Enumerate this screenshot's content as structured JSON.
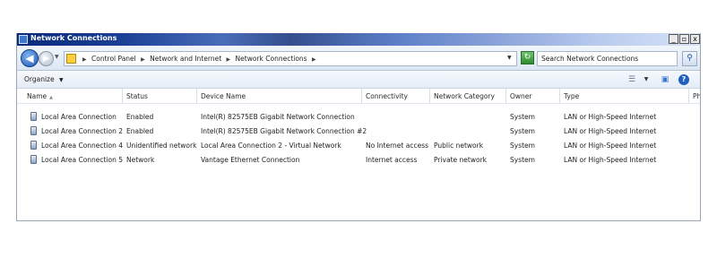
{
  "window": {
    "title": "Network Connections",
    "controls": {
      "minimize": "_",
      "maximize": "▫",
      "close": "x"
    }
  },
  "address": {
    "crumbs": [
      "Control Panel",
      "Network and Internet",
      "Network Connections"
    ],
    "search_placeholder": "Search Network Connections"
  },
  "toolbar": {
    "organize_label": "Organize"
  },
  "columns": [
    "Name",
    "Status",
    "Device Name",
    "Connectivity",
    "Network Category",
    "Owner",
    "Type",
    "Ph"
  ],
  "rows": [
    {
      "name": "Local Area Connection",
      "status": "Enabled",
      "device": "Intel(R) 82575EB Gigabit Network Connection",
      "connectivity": "",
      "category": "",
      "owner": "System",
      "type": "LAN or High-Speed Internet"
    },
    {
      "name": "Local Area Connection 2",
      "status": "Enabled",
      "device": "Intel(R) 82575EB Gigabit Network Connection #2",
      "connectivity": "",
      "category": "",
      "owner": "System",
      "type": "LAN or High-Speed Internet"
    },
    {
      "name": "Local Area Connection 4",
      "status": "Unidentified network",
      "device": "Local Area Connection 2 - Virtual Network",
      "connectivity": "No Internet access",
      "category": "Public network",
      "owner": "System",
      "type": "LAN or High-Speed Internet"
    },
    {
      "name": "Local Area Connection 5",
      "status": "Network",
      "device": "Vantage Ethernet Connection",
      "connectivity": "Internet access",
      "category": "Private network",
      "owner": "System",
      "type": "LAN or High-Speed Internet"
    }
  ],
  "icons": {
    "window": "network-connections-icon",
    "back": "back-arrow-icon",
    "forward": "forward-arrow-icon",
    "address": "control-panel-icon",
    "refresh": "refresh-icon",
    "search": "search-icon",
    "views": "views-icon",
    "preview": "preview-pane-icon",
    "help": "help-icon",
    "network_adapter": "network-adapter-icon"
  },
  "colors": {
    "titlebar_start": "#0a2a7a",
    "titlebar_end": "#d7e2f6",
    "accent": "#1f5fbf"
  }
}
